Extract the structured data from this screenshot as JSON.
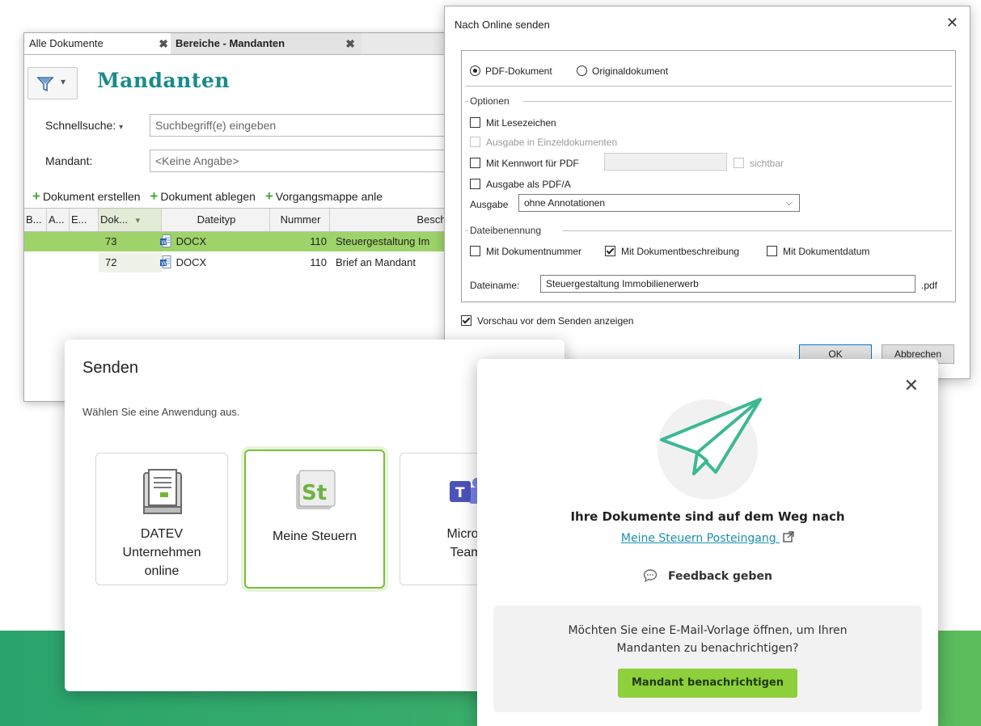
{
  "dms": {
    "tabs": [
      {
        "label": "Alle Dokumente",
        "close": "✖"
      },
      {
        "label": "Bereiche - Mandanten",
        "close": "✖"
      }
    ],
    "page_title": "Mandanten",
    "filter_arrow": "▾",
    "search": {
      "label": "Schnellsuche:",
      "dropdown_arrow": "▾",
      "placeholder": "Suchbegriff(e) eingeben"
    },
    "client": {
      "label": "Mandant:",
      "value": "<Keine Angabe>"
    },
    "actions": [
      {
        "label": "Dokument erstellen"
      },
      {
        "label": "Dokument ablegen"
      },
      {
        "label": "Vorgangsmappe anle"
      }
    ],
    "columns": [
      "B...",
      "A...",
      "E...",
      "Dok...",
      "Dateityp",
      "Nummer",
      "Beschrei"
    ],
    "sort_arrow": "▾",
    "rows": [
      {
        "dok": "73",
        "type": "DOCX",
        "number": "110",
        "desc": "Steuergestaltung Im"
      },
      {
        "dok": "72",
        "type": "DOCX",
        "number": "110",
        "desc": "Brief an Mandant"
      }
    ]
  },
  "online_dialog": {
    "title": "Nach Online senden",
    "close": "✕",
    "radio_pdf": "PDF-Dokument",
    "radio_original": "Originaldokument",
    "options_label": "Optionen",
    "opt_bookmarks": "Mit Lesezeichen",
    "opt_single_docs": "Ausgabe in Einzeldokumenten",
    "opt_password": "Mit Kennwort für PDF",
    "opt_visible": "sichtbar",
    "opt_pdfa": "Ausgabe als PDF/A",
    "output_label": "Ausgabe",
    "output_value": "ohne Annotationen",
    "naming_label": "Dateibenennung",
    "naming_number": "Mit Dokumentnummer",
    "naming_desc": "Mit Dokumentbeschreibung",
    "naming_date": "Mit Dokumentdatum",
    "filename_label": "Dateiname:",
    "filename_value": "Steuergestaltung Immobilienerwerb",
    "filename_ext": ".pdf",
    "preview_label": "Vorschau vor dem Senden anzeigen",
    "ok": "OK",
    "cancel": "Abbrechen"
  },
  "send_dialog": {
    "title": "Senden",
    "subtitle": "Wählen Sie eine Anwendung aus.",
    "apps": [
      {
        "line1": "DATEV",
        "line2": "Unternehmen",
        "line3": "online",
        "icon": "datev-document-icon"
      },
      {
        "line1": "Meine Steuern",
        "icon": "meine-steuern-icon",
        "icon_text": "St"
      },
      {
        "line1": "Micros",
        "line2": "Team",
        "icon": "microsoft-teams-icon",
        "icon_text": "T"
      }
    ]
  },
  "success_dialog": {
    "close": "✕",
    "message": "Ihre Dokumente sind auf dem Weg nach",
    "link": "Meine Steuern Posteingang",
    "feedback": "Feedback geben",
    "question_line1": "Möchten Sie eine E-Mail-Vorlage öffnen, um Ihren",
    "question_line2": "Mandanten zu benachrichtigen?",
    "notify_button": "Mandant benachrichtigen"
  },
  "colors": {
    "accent_teal": "#1a8b88",
    "selection_green": "#9ed36a",
    "button_green": "#8ecf3c",
    "link_blue": "#1a8fb0"
  }
}
